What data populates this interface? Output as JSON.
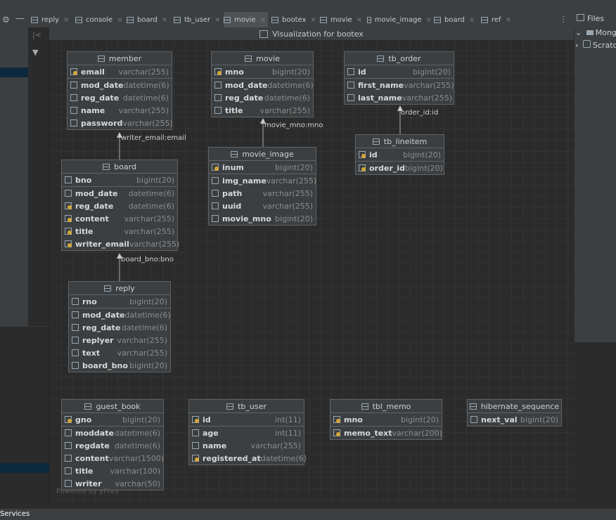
{
  "tabs": [
    {
      "label": "reply"
    },
    {
      "label": "console"
    },
    {
      "label": "board"
    },
    {
      "label": "tb_user"
    },
    {
      "label": "movie",
      "active": true
    },
    {
      "label": "bootex"
    },
    {
      "label": "movie"
    },
    {
      "label": "movie_image"
    },
    {
      "label": "board"
    },
    {
      "label": "ref"
    }
  ],
  "right_panel": {
    "files_label": "Files",
    "items": [
      "Mongo",
      "Scratc"
    ]
  },
  "canvas_title": "Visualization for bootex",
  "watermark": "Powered by yFiles",
  "status": {
    "services": "Services"
  },
  "tables": {
    "member": {
      "name": "member",
      "columns": [
        {
          "name": "email",
          "type": "varchar(255)",
          "key": true
        },
        {
          "name": "mod_date",
          "type": "datetime(6)"
        },
        {
          "name": "reg_date",
          "type": "datetime(6)"
        },
        {
          "name": "name",
          "type": "varchar(255)"
        },
        {
          "name": "password",
          "type": "varchar(255)"
        }
      ]
    },
    "movie": {
      "name": "movie",
      "columns": [
        {
          "name": "mno",
          "type": "bigint(20)",
          "key": true
        },
        {
          "name": "mod_date",
          "type": "datetime(6)"
        },
        {
          "name": "reg_date",
          "type": "datetime(6)"
        },
        {
          "name": "title",
          "type": "varchar(255)"
        }
      ]
    },
    "tb_order": {
      "name": "tb_order",
      "columns": [
        {
          "name": "id",
          "type": "bigint(20)"
        },
        {
          "name": "first_name",
          "type": "varchar(255)"
        },
        {
          "name": "last_name",
          "type": "varchar(255)"
        }
      ]
    },
    "board": {
      "name": "board",
      "columns": [
        {
          "name": "bno",
          "type": "bigint(20)"
        },
        {
          "name": "mod_date",
          "type": "datetime(6)"
        },
        {
          "name": "reg_date",
          "type": "datetime(6)",
          "key": true
        },
        {
          "name": "content",
          "type": "varchar(255)",
          "key": true
        },
        {
          "name": "title",
          "type": "varchar(255)",
          "key": true
        },
        {
          "name": "writer_email",
          "type": "varchar(255)",
          "key": true
        }
      ]
    },
    "movie_image": {
      "name": "movie_image",
      "columns": [
        {
          "name": "inum",
          "type": "bigint(20)",
          "key": true
        },
        {
          "name": "img_name",
          "type": "varchar(255)"
        },
        {
          "name": "path",
          "type": "varchar(255)"
        },
        {
          "name": "uuid",
          "type": "varchar(255)"
        },
        {
          "name": "movie_mno",
          "type": "bigint(20)"
        }
      ]
    },
    "tb_lineitem": {
      "name": "tb_lineitem",
      "columns": [
        {
          "name": "id",
          "type": "bigint(20)",
          "key": true
        },
        {
          "name": "order_id",
          "type": "bigint(20)",
          "key": true
        }
      ]
    },
    "reply": {
      "name": "reply",
      "columns": [
        {
          "name": "rno",
          "type": "bigint(20)"
        },
        {
          "name": "mod_date",
          "type": "datetime(6)"
        },
        {
          "name": "reg_date",
          "type": "datetime(6)"
        },
        {
          "name": "replyer",
          "type": "varchar(255)"
        },
        {
          "name": "text",
          "type": "varchar(255)"
        },
        {
          "name": "board_bno",
          "type": "bigint(20)"
        }
      ]
    },
    "guest_book": {
      "name": "guest_book",
      "columns": [
        {
          "name": "gno",
          "type": "bigint(20)",
          "key": true
        },
        {
          "name": "moddate",
          "type": "datetime(6)"
        },
        {
          "name": "regdate",
          "type": "datetime(6)"
        },
        {
          "name": "content",
          "type": "varchar(1500)"
        },
        {
          "name": "title",
          "type": "varchar(100)"
        },
        {
          "name": "writer",
          "type": "varchar(50)"
        }
      ]
    },
    "tb_user": {
      "name": "tb_user",
      "columns": [
        {
          "name": "id",
          "type": "int(11)",
          "key": true
        },
        {
          "name": "age",
          "type": "int(11)"
        },
        {
          "name": "name",
          "type": "varchar(255)"
        },
        {
          "name": "registered_at",
          "type": "datetime(6)",
          "key": true
        }
      ]
    },
    "tbl_memo": {
      "name": "tbl_memo",
      "columns": [
        {
          "name": "mno",
          "type": "bigint(20)",
          "key": true
        },
        {
          "name": "memo_text",
          "type": "varchar(200)",
          "key": true
        }
      ]
    },
    "hibernate_sequence": {
      "name": "hibernate_sequence",
      "columns": [
        {
          "name": "next_val",
          "type": "bigint(20)"
        }
      ]
    }
  },
  "edges": [
    {
      "label": "writer_email:email"
    },
    {
      "label": "movie_mno:mno"
    },
    {
      "label": "order_id:id"
    },
    {
      "label": "board_bno:bno"
    }
  ]
}
